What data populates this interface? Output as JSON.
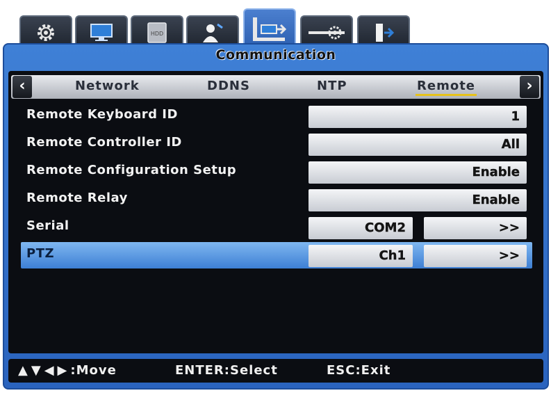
{
  "icon_tabs": [
    {
      "name": "gear-icon",
      "active": false
    },
    {
      "name": "monitor-icon",
      "active": false
    },
    {
      "name": "hdd-icon",
      "active": false,
      "label": "HDD"
    },
    {
      "name": "user-icon",
      "active": false
    },
    {
      "name": "network-communication-icon",
      "active": true
    },
    {
      "name": "settings-slider-icon",
      "active": false
    },
    {
      "name": "exit-door-icon",
      "active": false
    }
  ],
  "window": {
    "title": "Communication"
  },
  "subtabs": {
    "items": [
      "Network",
      "DDNS",
      "NTP",
      "Remote"
    ],
    "active": "Remote"
  },
  "rows": [
    {
      "label": "Remote Keyboard ID",
      "value": "1"
    },
    {
      "label": "Remote Controller ID",
      "value": "All"
    },
    {
      "label": "Remote Configuration Setup",
      "value": "Enable"
    },
    {
      "label": "Remote Relay",
      "value": "Enable"
    },
    {
      "label": "Serial",
      "value": "COM2",
      "action": ">>"
    },
    {
      "label": "PTZ",
      "value": "Ch1",
      "action": ">>",
      "selected": true
    }
  ],
  "help": {
    "move": ":Move",
    "select": "ENTER:Select",
    "exit": "ESC:Exit"
  },
  "colors": {
    "frame": "#3f80d6",
    "panel": "#0b0d12",
    "selected_row": "#7fb7f0",
    "tab_underline": "#e6c21a"
  }
}
